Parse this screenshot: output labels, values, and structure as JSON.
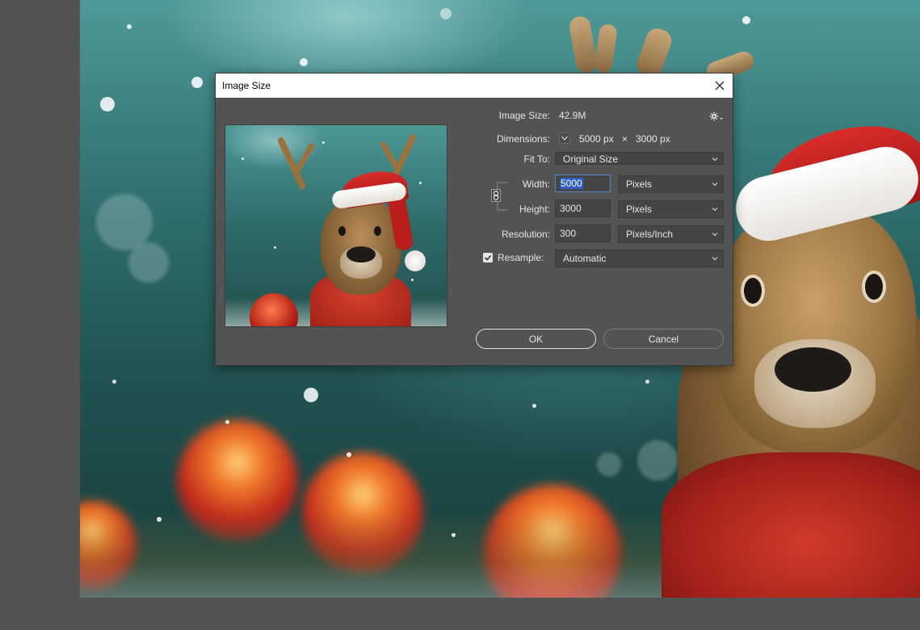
{
  "dialog": {
    "title": "Image Size",
    "image_size_label": "Image Size:",
    "image_size_value": "42.9M",
    "dimensions_label": "Dimensions:",
    "dimensions_width": "5000 px",
    "dimensions_times": "×",
    "dimensions_height": "3000 px",
    "fit_to_label": "Fit To:",
    "fit_to_value": "Original Size",
    "width_label": "Width:",
    "width_value": "5000",
    "width_unit": "Pixels",
    "height_label": "Height:",
    "height_value": "3000",
    "height_unit": "Pixels",
    "resolution_label": "Resolution:",
    "resolution_value": "300",
    "resolution_unit": "Pixels/Inch",
    "resample_label": "Resample:",
    "resample_checked": true,
    "resample_value": "Automatic",
    "ok_label": "OK",
    "cancel_label": "Cancel"
  },
  "icons": {
    "close": "close-icon",
    "gear": "gear-icon",
    "chevron": "chevron-down-icon",
    "link": "chain-link-icon",
    "check": "checkmark-icon"
  },
  "colors": {
    "dialog_bg": "#535353",
    "field_bg": "#454545",
    "text": "#e6e6e6",
    "selection": "#2f5fc4"
  }
}
